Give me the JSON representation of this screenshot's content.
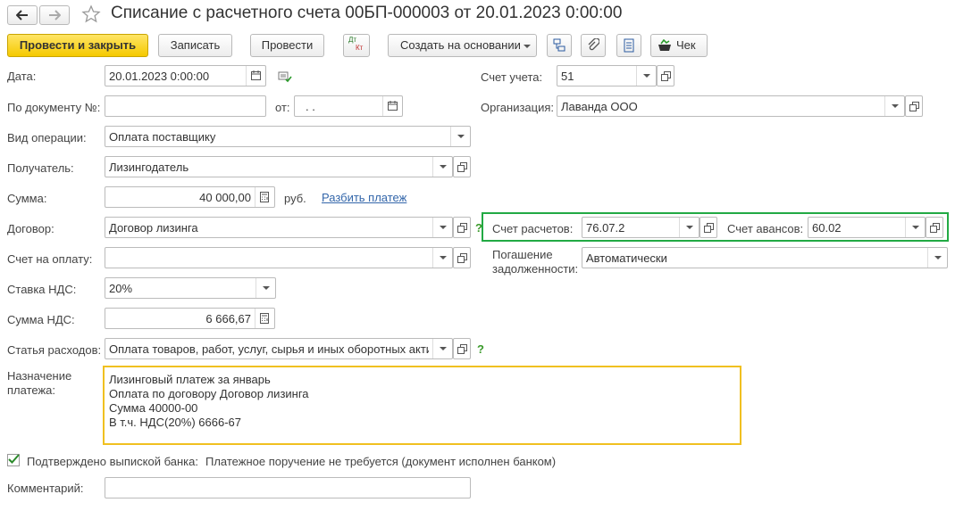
{
  "window": {
    "title": "Списание с расчетного счета 00БП-000003 от 20.01.2023 0:00:00"
  },
  "toolbar": {
    "post_close": "Провести и закрыть",
    "save": "Записать",
    "post": "Провести",
    "dtkt_top": "Дт",
    "dtkt_bottom": "Кт",
    "create_based": "Создать на основании",
    "check": "Чек"
  },
  "form": {
    "date_label": "Дата:",
    "date_value": "20.01.2023  0:00:00",
    "doc_no_label": "По документу №:",
    "doc_no_value": "",
    "from_label": "от:",
    "from_value": "  .  .",
    "op_type_label": "Вид операции:",
    "op_type_value": "Оплата поставщику",
    "recipient_label": "Получатель:",
    "recipient_value": "Лизингодатель",
    "sum_label": "Сумма:",
    "sum_value": "40 000,00",
    "currency": "руб.",
    "split_payment": "Разбить платеж",
    "contract_label": "Договор:",
    "contract_value": "Договор лизинга",
    "invoice_label": "Счет на оплату:",
    "invoice_value": "",
    "vat_rate_label": "Ставка НДС:",
    "vat_rate_value": "20%",
    "vat_sum_label": "Сумма НДС:",
    "vat_sum_value": "6 666,67",
    "expense_label": "Статья расходов:",
    "expense_value": "Оплата товаров, работ, услуг, сырья и иных оборотных акти",
    "purpose_label_1": "Назначение",
    "purpose_label_2": "платежа:",
    "purpose_lines": [
      "Лизинговый платеж за январь",
      "Оплата по договору Договор лизинга",
      "Сумма 40000-00",
      "В т.ч. НДС(20%) 6666-67"
    ],
    "bank_confirmed_label": "Подтверждено выпиской банка:",
    "bank_confirmed_note": "Платежное поручение не требуется (документ исполнен банком)",
    "comment_label": "Комментарий:",
    "comment_value": "",
    "question_mark": "?"
  },
  "right": {
    "account_label": "Счет учета:",
    "account_value": "51",
    "org_label": "Организация:",
    "org_value": "Лаванда ООО",
    "settle_label": "Счет расчетов:",
    "settle_value": "76.07.2",
    "advance_label": "Счет авансов:",
    "advance_value": "60.02",
    "repay_label_1": "Погашение",
    "repay_label_2": "задолженности:",
    "repay_value": "Автоматически"
  },
  "colors": {
    "highlight_green": "#22aa44",
    "highlight_yellow": "#f0c020",
    "primary_button": "#f5c900"
  }
}
